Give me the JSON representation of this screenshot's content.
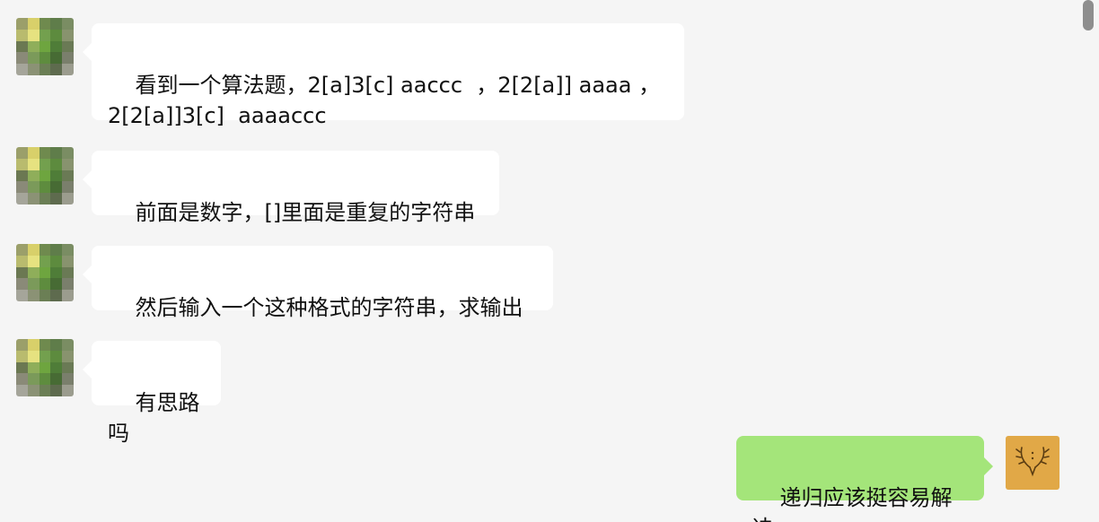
{
  "messages": [
    {
      "side": "left",
      "text": "看到一个算法题，2[a]3[c] aaccc  ，2[2[a]] aaaa ，\n2[2[a]]3[c]  aaaaccc"
    },
    {
      "side": "left",
      "text": "前面是数字，[]里面是重复的字符串"
    },
    {
      "side": "left",
      "text": "然后输入一个这种格式的字符串，求输出"
    },
    {
      "side": "left",
      "text": "有思路吗"
    },
    {
      "side": "right",
      "text": "递归应该挺容易解决"
    }
  ],
  "self_avatar": {
    "icon": "antlers-crest-icon",
    "color": "#e1a847"
  },
  "colors": {
    "incoming_bubble": "#ffffff",
    "outgoing_bubble": "#a4e57a",
    "background": "#f5f5f5"
  }
}
